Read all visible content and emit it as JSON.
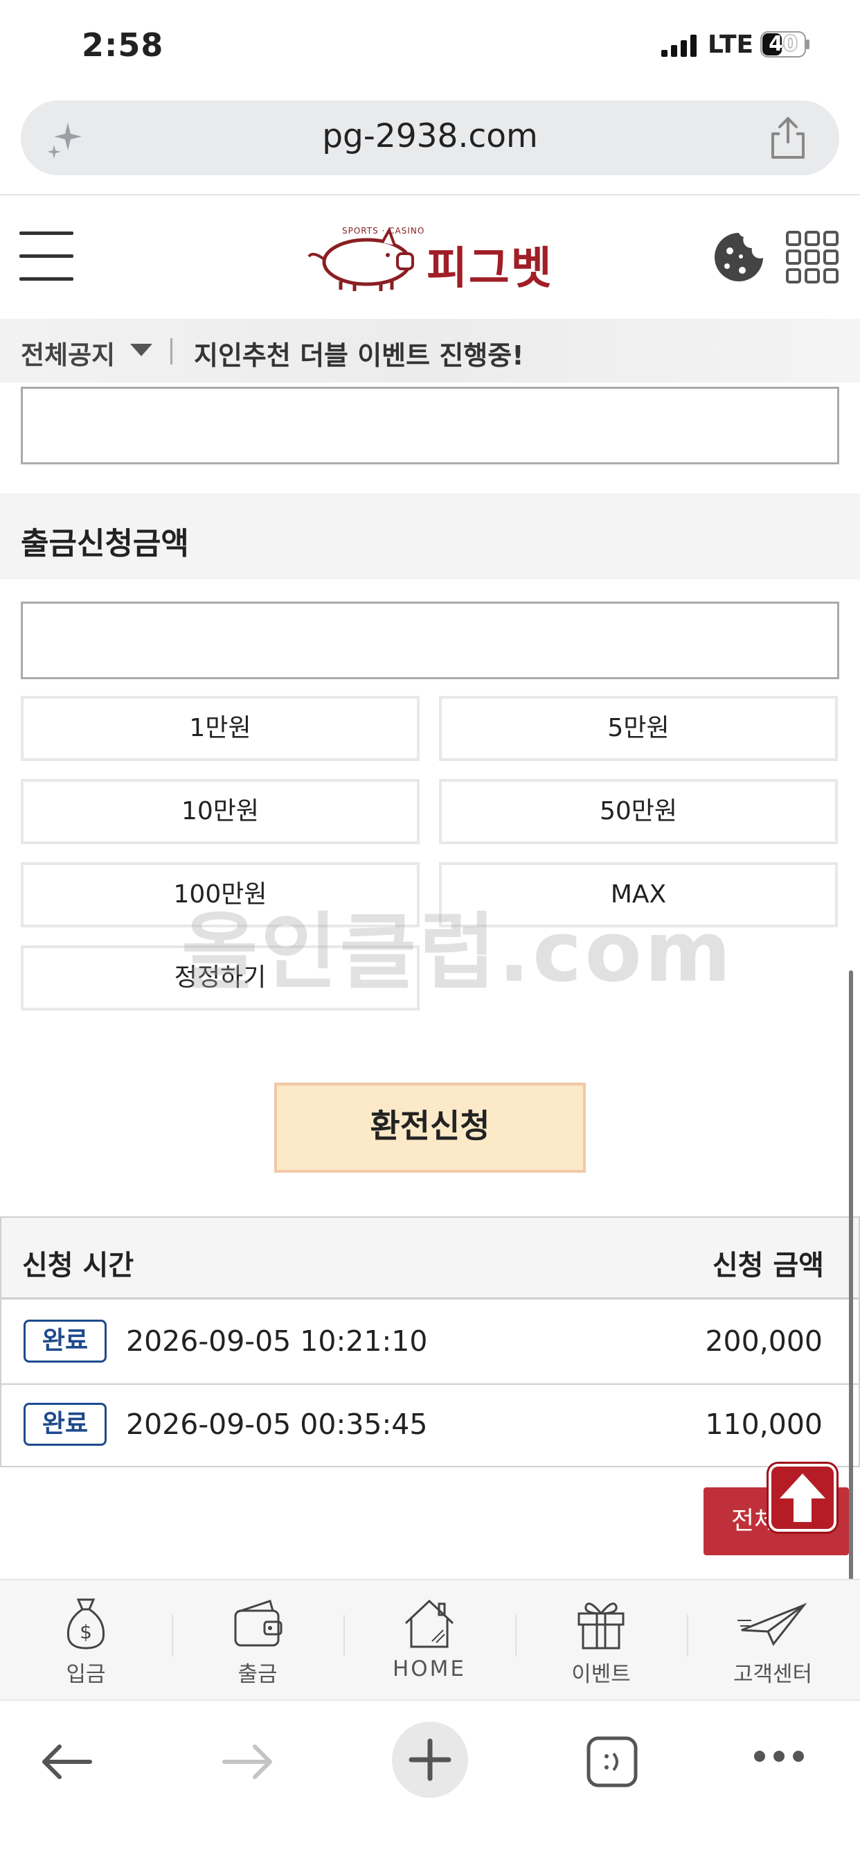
{
  "status_bar": {
    "time": "2:58",
    "network": "LTE",
    "battery": "40"
  },
  "browser": {
    "url": "pg-2938.com"
  },
  "header": {
    "logo_text": "피그벳",
    "logo_subtext": "SPORTS · CASINO"
  },
  "notice": {
    "category": "전체공지",
    "text": "지인추천 더블 이벤트 진행중!"
  },
  "form": {
    "section_title": "출금신청금액",
    "amount_buttons": [
      "1만원",
      "5만원",
      "10만원",
      "50만원",
      "100만원",
      "MAX",
      "정정하기"
    ],
    "submit_label": "환전신청"
  },
  "watermark": "올인클럽.com",
  "history": {
    "col_time": "신청 시간",
    "col_amount": "신청 금액",
    "rows": [
      {
        "status": "완료",
        "time": "2026-09-05 10:21:10",
        "amount": "200,000"
      },
      {
        "status": "완료",
        "time": "2026-09-05 00:35:45",
        "amount": "110,000"
      }
    ],
    "all_button": "전체"
  },
  "bottom_nav": [
    "입금",
    "출금",
    "HOME",
    "이벤트",
    "고객센터"
  ],
  "colors": {
    "brand_red": "#b51c26",
    "submit_bg": "#fbe9c8",
    "badge_blue": "#1e4a8c"
  }
}
